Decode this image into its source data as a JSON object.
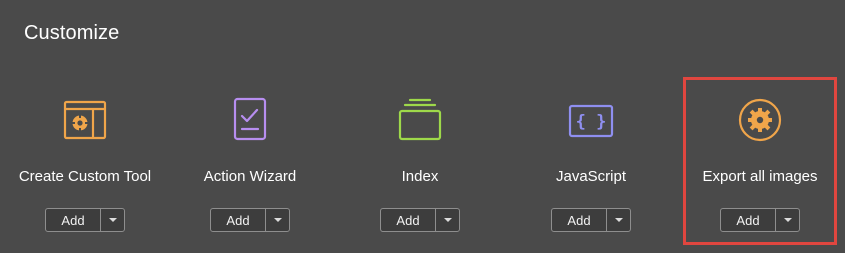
{
  "section": {
    "title": "Customize"
  },
  "tools": [
    {
      "label": "Create Custom Tool",
      "icon": "custom-tool-gear-icon",
      "accent": "#f0a54a",
      "add_label": "Add"
    },
    {
      "label": "Action Wizard",
      "icon": "action-wizard-checklist-icon",
      "accent": "#b78ef0",
      "add_label": "Add"
    },
    {
      "label": "Index",
      "icon": "index-stack-icon",
      "accent": "#9ed94a",
      "add_label": "Add"
    },
    {
      "label": "JavaScript",
      "icon": "javascript-braces-icon",
      "accent": "#8f8ff0",
      "add_label": "Add"
    },
    {
      "label": "Export all images",
      "icon": "export-images-gear-icon",
      "accent": "#f0a54a",
      "add_label": "Add"
    }
  ],
  "highlight": {
    "color": "#e0463f",
    "target": "Export all images"
  }
}
